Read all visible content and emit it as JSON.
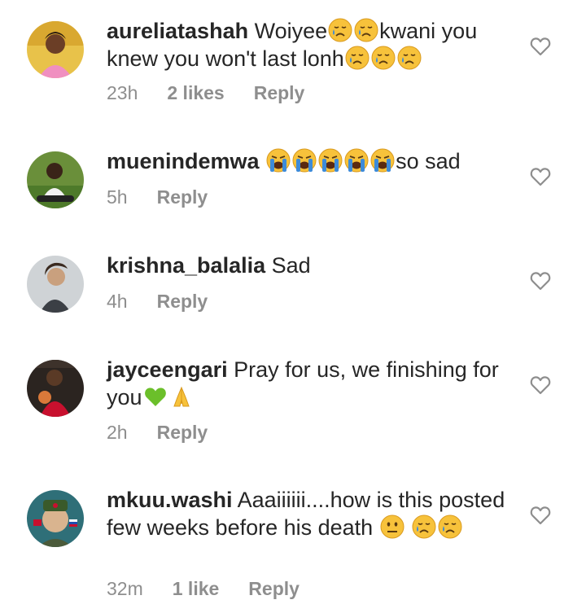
{
  "comments": [
    {
      "username": "aureliatashah",
      "text_parts": [
        "Woiyee",
        "kwani you knew you won't last lonh"
      ],
      "time": "23h",
      "likes": "2 likes",
      "reply": "Reply"
    },
    {
      "username": "muenindemwa",
      "text_parts": [
        "so sad"
      ],
      "time": "5h",
      "reply": "Reply"
    },
    {
      "username": "krishna_balalia",
      "text_parts": [
        "Sad"
      ],
      "time": "4h",
      "reply": "Reply"
    },
    {
      "username": "jayceengari",
      "text_parts": [
        "Pray for us, we finishing for you"
      ],
      "time": "2h",
      "reply": "Reply"
    },
    {
      "username": "mkuu.washi",
      "text_parts": [
        "Aaaiiiiii....how is this posted few weeks before his death"
      ],
      "time": "32m",
      "likes": "1 like",
      "reply": "Reply"
    }
  ],
  "icons": {
    "heart": "heart-outline-icon",
    "crying": "crying-face-emoji",
    "loudly_crying": "loudly-crying-face-emoji",
    "green_heart": "green-heart-emoji",
    "folded_hands": "folded-hands-emoji",
    "neutral": "neutral-face-emoji"
  },
  "colors": {
    "text": "#262626",
    "meta": "#8e8e8e",
    "emoji_yellow": "#f7c23b",
    "tear_blue": "#3d8bd9",
    "green_heart": "#6bbf2a"
  }
}
